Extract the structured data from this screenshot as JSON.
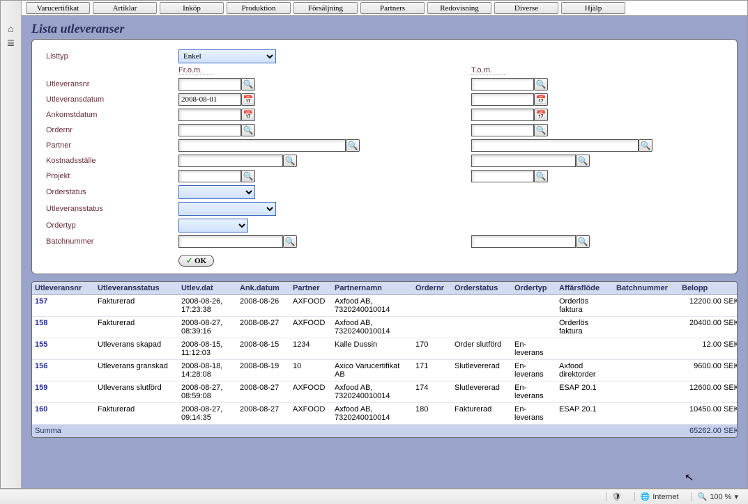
{
  "menubar": [
    "Varucertifikat",
    "Artiklar",
    "Inköp",
    "Produktion",
    "Försäljning",
    "Partners",
    "Redovisning",
    "Diverse",
    "Hjälp"
  ],
  "page_title": "Lista utleveranser",
  "labels": {
    "listtyp": "Listtyp",
    "from": "Fr.o.m.",
    "tom": "T.o.m.",
    "utleveransnr": "Utleveransnr",
    "utleveransdatum": "Utleveransdatum",
    "ankomstdatum": "Ankomstdatum",
    "ordernr": "Ordernr",
    "partner": "Partner",
    "kostnadsstalle": "Kostnadsställe",
    "projekt": "Projekt",
    "orderstatus": "Orderstatus",
    "utleveransstatus": "Utleveransstatus",
    "ordertyp": "Ordertyp",
    "batchnummer": "Batchnummer",
    "ok": "OK"
  },
  "values": {
    "listtyp": "Enkel",
    "utleveransdatum_from": "2008-08-01"
  },
  "table": {
    "headers": [
      "Utleveransnr",
      "Utleveransstatus",
      "Utlev.dat",
      "Ank.datum",
      "Partner",
      "Partnernamn",
      "Ordernr",
      "Orderstatus",
      "Ordertyp",
      "Affärsflöde",
      "Batchnummer",
      "Belopp"
    ],
    "rows": [
      {
        "nr": "157",
        "status": "Fakturerad",
        "utlevdat": "2008-08-26, 17:23:38",
        "ankdat": "2008-08-26",
        "partner": "AXFOOD",
        "partnernamn": "Axfood AB, 7320240010014",
        "ordernr": "",
        "orderstatus": "",
        "ordertyp": "",
        "flow": "Orderlös faktura",
        "batch": "",
        "belopp": "12200.00 SEK"
      },
      {
        "nr": "158",
        "status": "Fakturerad",
        "utlevdat": "2008-08-27, 08:39:16",
        "ankdat": "2008-08-27",
        "partner": "AXFOOD",
        "partnernamn": "Axfood AB, 7320240010014",
        "ordernr": "",
        "orderstatus": "",
        "ordertyp": "",
        "flow": "Orderlös faktura",
        "batch": "",
        "belopp": "20400.00 SEK"
      },
      {
        "nr": "155",
        "status": "Utleverans skapad",
        "utlevdat": "2008-08-15, 11:12:03",
        "ankdat": "2008-08-15",
        "partner": "1234",
        "partnernamn": "Kalle Dussin",
        "ordernr": "170",
        "orderstatus": "Order slutförd",
        "ordertyp": "En-leverans",
        "flow": "",
        "batch": "",
        "belopp": "12.00 SEK"
      },
      {
        "nr": "156",
        "status": "Utleverans granskad",
        "utlevdat": "2008-08-18, 14:28:08",
        "ankdat": "2008-08-19",
        "partner": "10",
        "partnernamn": "Axico Varucertifikat AB",
        "ordernr": "171",
        "orderstatus": "Slutlevererad",
        "ordertyp": "En-leverans",
        "flow": "Axfood direktorder",
        "batch": "",
        "belopp": "9600.00 SEK"
      },
      {
        "nr": "159",
        "status": "Utleverans slutförd",
        "utlevdat": "2008-08-27, 08:59:08",
        "ankdat": "2008-08-27",
        "partner": "AXFOOD",
        "partnernamn": "Axfood AB, 7320240010014",
        "ordernr": "174",
        "orderstatus": "Slutlevererad",
        "ordertyp": "En-leverans",
        "flow": "ESAP 20.1",
        "batch": "",
        "belopp": "12600.00 SEK"
      },
      {
        "nr": "160",
        "status": "Fakturerad",
        "utlevdat": "2008-08-27, 09:14:35",
        "ankdat": "2008-08-27",
        "partner": "AXFOOD",
        "partnernamn": "Axfood AB, 7320240010014",
        "ordernr": "180",
        "orderstatus": "Fakturerad",
        "ordertyp": "En-leverans",
        "flow": "ESAP 20.1",
        "batch": "",
        "belopp": "10450.00 SEK"
      }
    ],
    "footer": {
      "label": "Summa",
      "total": "65262.00 SEK"
    }
  },
  "statusbar": {
    "zone": "Internet",
    "zoom": "100 %"
  }
}
